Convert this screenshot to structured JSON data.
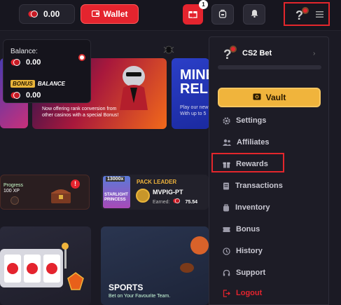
{
  "topbar": {
    "balance_value": "0.00",
    "wallet_label": "Wallet",
    "notification_count": "1"
  },
  "balance_dropdown": {
    "balance_label": "Balance:",
    "balance_value": "0.00",
    "bonus_tag": "BONUS",
    "bonus_label": "BALANCE",
    "bonus_value": "0.00"
  },
  "promo_banner": {
    "text_line1": "Now offering rank conversion from",
    "text_line2": "other casinos with a special Bonus!"
  },
  "release_banner": {
    "title_line1": "MINE",
    "title_line2": "RELEA",
    "text_line1": "Play our new",
    "text_line2": "With up to 5"
  },
  "progress_card": {
    "label": "Progress",
    "xp": "100 XP",
    "badge": "!"
  },
  "pack_leader": {
    "header": "PACK LEADER",
    "username": "MVPIG-PT",
    "earned_label": "Earned:",
    "earned_value": "75.54",
    "game_value": "13000x",
    "game_title_line1": "STARLIGHT",
    "game_title_line2": "PRINCESS"
  },
  "sports_card": {
    "title": "SPORTS",
    "subtitle": "Bet on Your Favourite Team."
  },
  "menu": {
    "username": "CS2 Bet",
    "vault_label": "Vault",
    "items": [
      {
        "label": "Settings",
        "icon": "gear-icon"
      },
      {
        "label": "Affiliates",
        "icon": "people-icon"
      },
      {
        "label": "Rewards",
        "icon": "gift-icon"
      },
      {
        "label": "Transactions",
        "icon": "receipt-icon"
      },
      {
        "label": "Inventory",
        "icon": "backpack-icon"
      },
      {
        "label": "Bonus",
        "icon": "bonus-icon"
      },
      {
        "label": "History",
        "icon": "clock-icon"
      },
      {
        "label": "Support",
        "icon": "headset-icon"
      },
      {
        "label": "Logout",
        "icon": "logout-icon"
      }
    ]
  },
  "colors": {
    "accent_red": "#e4242e",
    "vault_gold": "#f0b43c",
    "highlight_box": "#e3262c",
    "background": "#1b1a24"
  }
}
